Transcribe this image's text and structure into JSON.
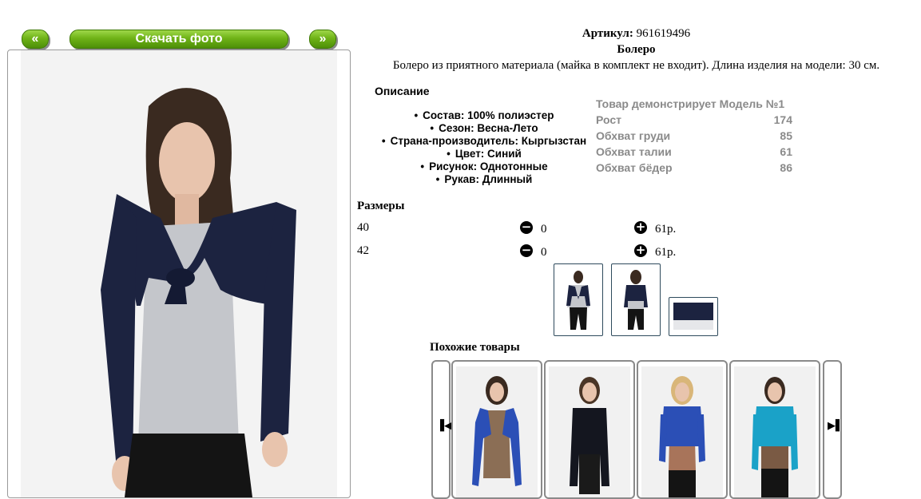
{
  "nav": {
    "prev_label": "«",
    "download_label": "Скачать фото",
    "next_label": "»"
  },
  "product": {
    "sku_label": "Артикул:",
    "sku_value": "961619496",
    "title": "Болеро",
    "description": "Болеро из приятного материала (майка в комплект не входит). Длина изделия на модели: 30 см."
  },
  "details": {
    "heading": "Описание",
    "attributes": [
      "Состав: 100% полиэстер",
      "Сезон: Весна-Лето",
      "Страна-производитель: Кыргызстан",
      "Цвет: Синий",
      "Рисунок: Однотонные",
      "Рукав: Длинный"
    ]
  },
  "model": {
    "heading": "Товар демонстрирует Модель №1",
    "rows": [
      {
        "label": "Рост",
        "value": "174"
      },
      {
        "label": "Обхват груди",
        "value": "85"
      },
      {
        "label": "Обхват талии",
        "value": "61"
      },
      {
        "label": "Обхват бёдер",
        "value": "86"
      }
    ]
  },
  "sizes": {
    "heading": "Размеры",
    "rows": [
      {
        "size": "40",
        "qty": "0",
        "price": "61р."
      },
      {
        "size": "42",
        "qty": "0",
        "price": "61р."
      }
    ]
  },
  "similar": {
    "heading": "Похожие товары",
    "prev_icon": "▐◀",
    "next_icon": "▶▌"
  },
  "colors": {
    "accent_green": "#6fb317",
    "garment_navy": "#1c2340",
    "garment_grey": "#c4c6cb"
  }
}
